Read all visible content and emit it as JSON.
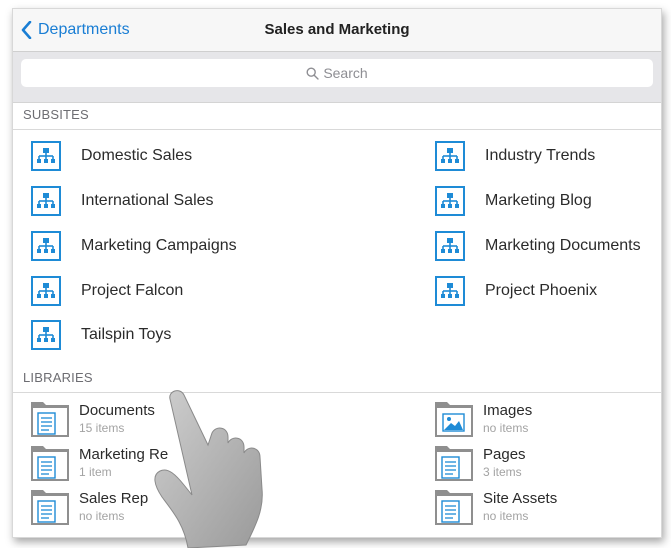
{
  "navbar": {
    "back_label": "Departments",
    "title": "Sales and Marketing"
  },
  "search": {
    "placeholder": "Search"
  },
  "subsites": {
    "header": "SUBSITES",
    "left": [
      {
        "label": "Domestic Sales"
      },
      {
        "label": "International Sales"
      },
      {
        "label": "Marketing Campaigns"
      },
      {
        "label": "Project Falcon"
      },
      {
        "label": "Tailspin Toys"
      }
    ],
    "right": [
      {
        "label": "Industry Trends"
      },
      {
        "label": "Marketing Blog"
      },
      {
        "label": "Marketing Documents"
      },
      {
        "label": "Project Phoenix"
      }
    ]
  },
  "libraries": {
    "header": "LIBRARIES",
    "left": [
      {
        "name": "Documents",
        "count": "15 items",
        "icon": "document-library-icon"
      },
      {
        "name": "Marketing Re",
        "count": "1 item",
        "icon": "document-library-icon"
      },
      {
        "name": "Sales Rep",
        "count": "no items",
        "icon": "document-library-icon"
      }
    ],
    "right": [
      {
        "name": "Images",
        "count": "no items",
        "icon": "image-library-icon"
      },
      {
        "name": "Pages",
        "count": "3 items",
        "icon": "document-library-icon"
      },
      {
        "name": "Site Assets",
        "count": "no items",
        "icon": "document-library-icon"
      }
    ]
  },
  "colors": {
    "accent": "#1a7ed4",
    "site_icon": "#1e8bd6"
  }
}
